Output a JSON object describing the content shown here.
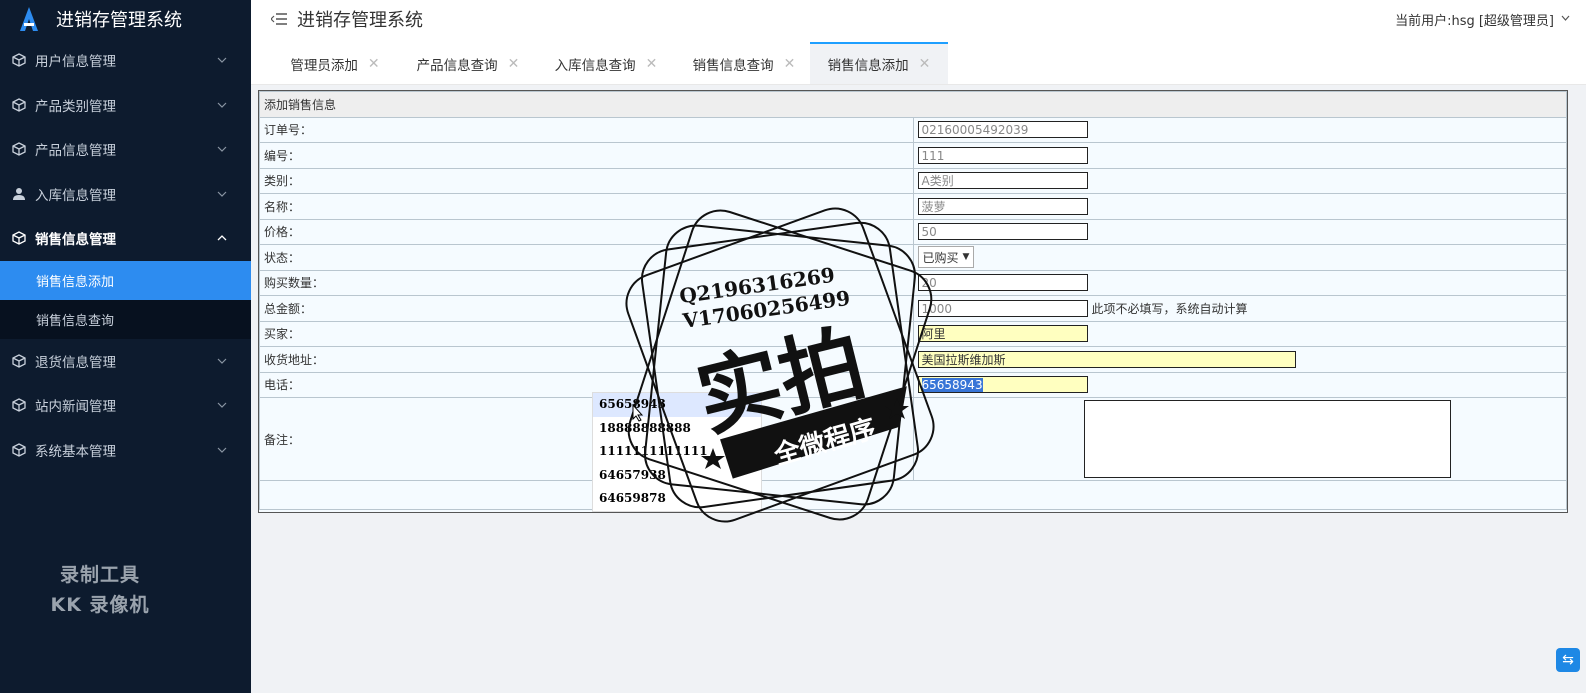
{
  "app": {
    "title": "进销存管理系统"
  },
  "header": {
    "title": "进销存管理系统",
    "user": "当前用户:hsg [超级管理员]"
  },
  "sidebar": {
    "items": [
      {
        "label": "用户信息管理",
        "icon": "cube-icon"
      },
      {
        "label": "产品类别管理",
        "icon": "cube-icon"
      },
      {
        "label": "产品信息管理",
        "icon": "cube-icon"
      },
      {
        "label": "入库信息管理",
        "icon": "user-icon"
      },
      {
        "label": "销售信息管理",
        "icon": "cube-icon",
        "open": true,
        "children": [
          {
            "label": "销售信息添加",
            "active": true
          },
          {
            "label": "销售信息查询"
          }
        ]
      },
      {
        "label": "退货信息管理",
        "icon": "cube-icon"
      },
      {
        "label": "站内新闻管理",
        "icon": "cube-icon"
      },
      {
        "label": "系统基本管理",
        "icon": "cube-icon"
      }
    ],
    "watermark": [
      "录制工具",
      "KK 录像机"
    ]
  },
  "tabs": [
    {
      "label": "管理员添加"
    },
    {
      "label": "产品信息查询"
    },
    {
      "label": "入库信息查询"
    },
    {
      "label": "销售信息查询"
    },
    {
      "label": "销售信息添加",
      "active": true
    }
  ],
  "form": {
    "caption": "添加销售信息",
    "fields": {
      "order_no": {
        "label": "订单号：",
        "value": "02160005492039"
      },
      "code": {
        "label": "编号：",
        "value": "111"
      },
      "category": {
        "label": "类别：",
        "value": "A类别"
      },
      "name": {
        "label": "名称：",
        "value": "菠萝"
      },
      "price": {
        "label": "价格：",
        "value": "50"
      },
      "status": {
        "label": "状态：",
        "value": "已购买"
      },
      "quantity": {
        "label": "购买数量：",
        "value": "20"
      },
      "total": {
        "label": "总金额：",
        "value": "1000",
        "tip": "此项不必填写，系统自动计算"
      },
      "buyer": {
        "label": "买家：",
        "value": "阿里"
      },
      "address": {
        "label": "收货地址：",
        "value": "美国拉斯维加斯"
      },
      "phone": {
        "label": "电话：",
        "value": "65658943"
      },
      "remark": {
        "label": "备注：",
        "value": ""
      }
    }
  },
  "autocomplete": [
    "65658943",
    "18888888888",
    "1111111111111",
    "64657938",
    "64659878"
  ],
  "stamp": {
    "lines": [
      "Q2196316269",
      "V17060256499"
    ],
    "main": "实拍",
    "banner": "全微程序"
  }
}
